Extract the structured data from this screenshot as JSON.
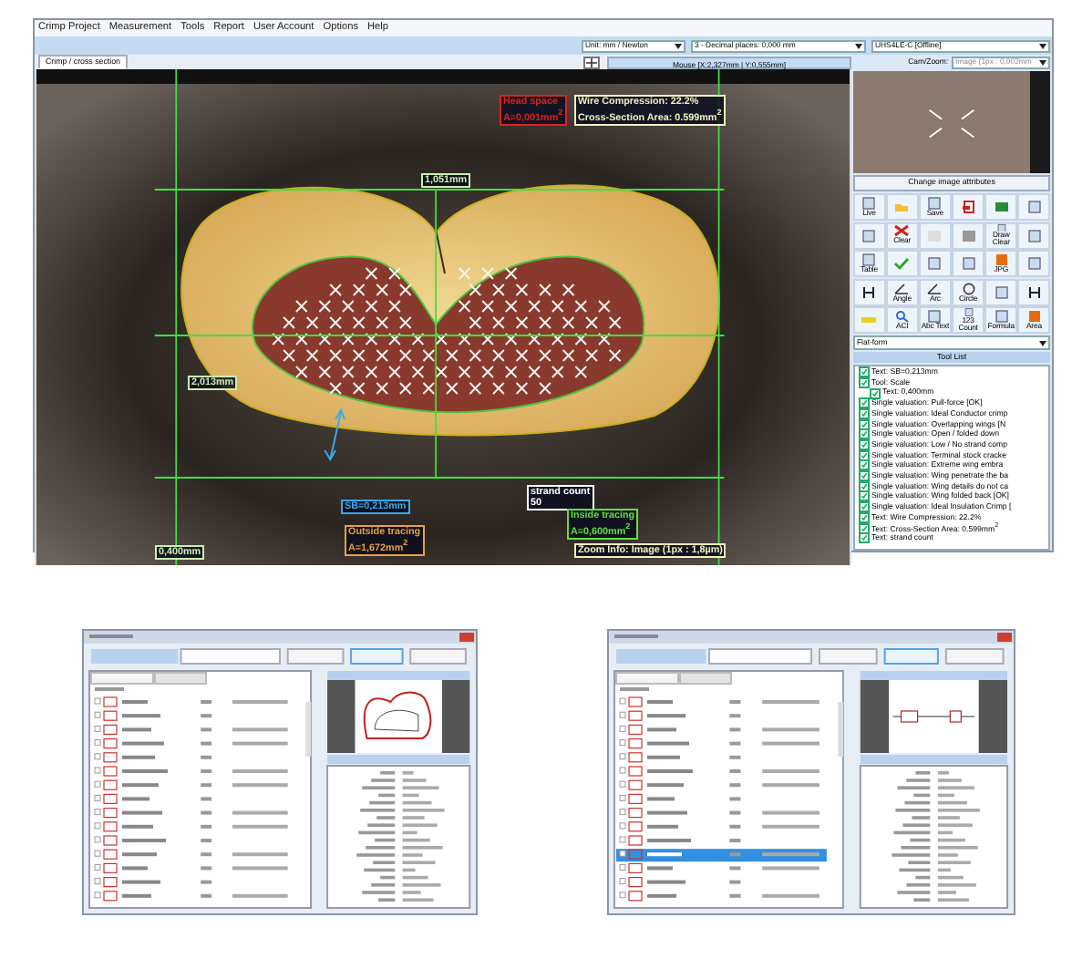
{
  "menu": [
    "Crimp Project",
    "Measurement",
    "Tools",
    "Report",
    "User Account",
    "Options",
    "Help"
  ],
  "toolbar": {
    "unit_select": "Unit: mm / Newton",
    "decimal_select": "3 - Decimal places: 0,000 mm",
    "device_select": "UHS4LE-C [Offline]"
  },
  "tabs": [
    {
      "label": "Crimp / cross section",
      "selected": true
    }
  ],
  "mouse_position": "Mouse [X:2,327mm | Y:0,555mm]",
  "image_labels": [
    {
      "lines": [
        "Head space",
        "A=0,001mm$^{2}$"
      ],
      "color": "#e02020"
    },
    {
      "lines": [
        "Wire Compression: 22.2%",
        "Cross-Section Area: 0.599mm$^{2}$"
      ],
      "color": "#f2f0c0"
    },
    {
      "lines": [
        "1,051mm"
      ],
      "color": "#c8f0b0"
    },
    {
      "lines": [
        "2,013mm"
      ],
      "color": "#c8f0b0"
    },
    {
      "lines": [
        "SB=0,213mm"
      ],
      "color": "#3aa8e8"
    },
    {
      "lines": [
        "strand count",
        "50"
      ],
      "color": "#ffffff"
    },
    {
      "lines": [
        "Outside tracing",
        "A=1,672mm$^{2}$"
      ],
      "color": "#e8a040"
    },
    {
      "lines": [
        "Inside tracing",
        "A=0,600mm$^{2}$"
      ],
      "color": "#60e040"
    },
    {
      "lines": [
        "0,400mm"
      ],
      "color": "#c8f0b0"
    },
    {
      "lines": [
        "Zoom Info: Image (1px : 1,8µm)"
      ],
      "color": "#f2f0c0"
    }
  ],
  "camera": {
    "label": "Cam/Zoom:",
    "zoom_select": "Image (1px : 0,002mm"
  },
  "change_image_button": "Change image attributes",
  "tool_buttons": [
    "Live",
    "Save",
    "Clear",
    "Draw Clear",
    "Table",
    "JPG",
    "Angle",
    "Arc",
    "Circle",
    "ACI",
    "Abc Text",
    "123 Count",
    "Formula",
    "Area"
  ],
  "form_select": "Flat-form",
  "tool_list": {
    "title": "Tool List",
    "items": [
      {
        "label": "Text: SB=0,213mm",
        "checked": true
      },
      {
        "label": "Tool: Scale",
        "checked": true,
        "children": [
          {
            "label": "Text: 0,400mm",
            "checked": true
          }
        ]
      },
      {
        "label": "Single valuation: Pull-force [OK]",
        "checked": true
      },
      {
        "label": "Single valuation: Ideal Conductor crimp",
        "checked": true
      },
      {
        "label": "Single valuation: Overlapping wings [N",
        "checked": true
      },
      {
        "label": "Single valuation: Open / folded down",
        "checked": true
      },
      {
        "label": "Single valuation: Low / No strand comp",
        "checked": true
      },
      {
        "label": "Single valuation: Terminal stock cracke",
        "checked": true
      },
      {
        "label": "Single valuation: Extreme wing embra",
        "checked": true
      },
      {
        "label": "Single valuation: Wing penetrate the ba",
        "checked": true
      },
      {
        "label": "Single valuation: Wing details do not ca",
        "checked": true
      },
      {
        "label": "Single valuation: Wing folded back [OK]",
        "checked": true
      },
      {
        "label": "Single valuation: Ideal Insulation Crimp [",
        "checked": true
      },
      {
        "label": "Text: Wire Compression: 22.2%",
        "checked": true
      },
      {
        "label": "Text: Cross-Section Area: 0.599mm$^{2}$",
        "checked": true
      },
      {
        "label": "Text: strand count",
        "checked": true
      }
    ]
  }
}
